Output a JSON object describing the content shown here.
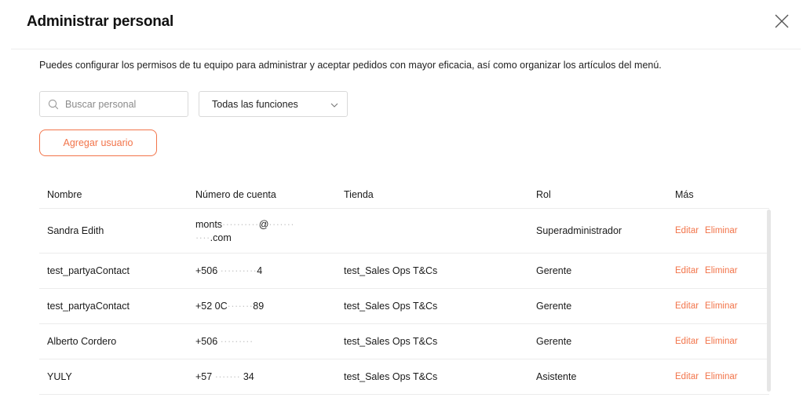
{
  "dialog": {
    "title": "Administrar personal",
    "description": "Puedes configurar los permisos de tu equipo para administrar y aceptar pedidos con mayor eficacia, así como organizar los artículos del menú."
  },
  "filters": {
    "search_placeholder": "Buscar personal",
    "role_filter_value": "Todas las funciones"
  },
  "actions": {
    "add_user_label": "Agregar usuario"
  },
  "table": {
    "headers": {
      "name": "Nombre",
      "account": "Número de cuenta",
      "store": "Tienda",
      "role": "Rol",
      "more": "Más"
    },
    "rows": [
      {
        "name": "Sandra Edith",
        "account_line1": "monts",
        "account_mask1": "··········",
        "account_line1b": "@",
        "account_mask1b": "·······",
        "account_line2_mask": "····",
        "account_line2": ".com",
        "store": "",
        "role": "Superadministrador",
        "edit": "Editar",
        "delete": "Eliminar"
      },
      {
        "name": "test_partyaContact",
        "account_prefix": "+506",
        "account_mask": "··········",
        "account_suffix": "4",
        "store": "test_Sales Ops T&Cs",
        "role": "Gerente",
        "edit": "Editar",
        "delete": "Eliminar"
      },
      {
        "name": "test_partyaContact",
        "account_prefix": "+52 0C",
        "account_mask": "·······",
        "account_suffix": "89",
        "store": "test_Sales Ops T&Cs",
        "role": "Gerente",
        "edit": "Editar",
        "delete": "Eliminar"
      },
      {
        "name": "Alberto Cordero",
        "account_prefix": "+506",
        "account_mask": "·········",
        "account_suffix": "",
        "store": "test_Sales Ops T&Cs",
        "role": "Gerente",
        "edit": "Editar",
        "delete": "Eliminar"
      },
      {
        "name": "YULY",
        "account_prefix": "+57",
        "account_mask": "·······",
        "account_suffix": "34",
        "store": "test_Sales Ops T&Cs",
        "role": "Asistente",
        "edit": "Editar",
        "delete": "Eliminar"
      }
    ]
  },
  "icons": {
    "close": "close-icon",
    "search": "search-icon",
    "dropdown": "chevron-down-icon"
  },
  "colors": {
    "accent": "#f2744a",
    "border": "#d9d9d9",
    "divider": "#ececec"
  }
}
